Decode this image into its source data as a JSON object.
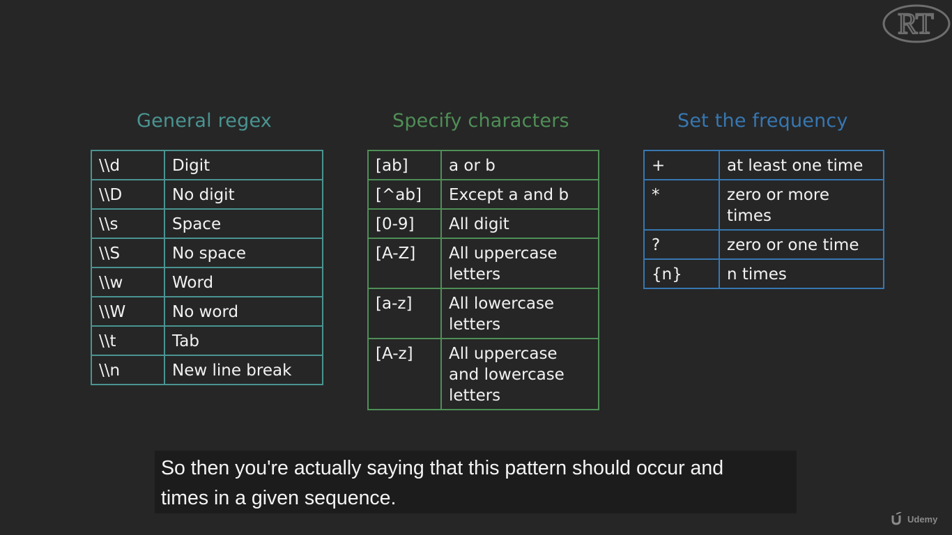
{
  "logo": {
    "text": "RT"
  },
  "sections": {
    "general": {
      "title": "General regex",
      "color": "#4a9491"
    },
    "specify": {
      "title": "Specify characters",
      "color": "#4f8f57"
    },
    "frequency": {
      "title": "Set the frequency",
      "color": "#3777b1"
    }
  },
  "general_rows": [
    {
      "key": "\\\\d",
      "desc": "Digit"
    },
    {
      "key": "\\\\D",
      "desc": "No digit"
    },
    {
      "key": "\\\\s",
      "desc": "Space"
    },
    {
      "key": "\\\\S",
      "desc": "No space"
    },
    {
      "key": "\\\\w",
      "desc": "Word"
    },
    {
      "key": "\\\\W",
      "desc": "No word"
    },
    {
      "key": "\\\\t",
      "desc": "Tab"
    },
    {
      "key": "\\\\n",
      "desc": "New line break"
    }
  ],
  "specify_rows": [
    {
      "key": "[ab]",
      "desc": "a or b"
    },
    {
      "key": "[^ab]",
      "desc": "Except a and b"
    },
    {
      "key": "[0-9]",
      "desc": "All digit"
    },
    {
      "key": "[A-Z]",
      "desc": "All uppercase letters"
    },
    {
      "key": "[a-z]",
      "desc": "All lowercase letters"
    },
    {
      "key": "[A-z]",
      "desc": "All uppercase and lowercase letters"
    }
  ],
  "frequency_rows": [
    {
      "key": "+",
      "desc": "at least one time"
    },
    {
      "key": "*",
      "desc": "zero or more times"
    },
    {
      "key": "?",
      "desc": "zero or one time"
    },
    {
      "key": "{n}",
      "desc": "n times"
    }
  ],
  "subtitle": {
    "line1": "So then you're actually saying that this pattern should occur and",
    "line2": "times in a given sequence."
  },
  "watermark": {
    "brand": "Udemy",
    "icon": "udemy-logo-icon"
  }
}
